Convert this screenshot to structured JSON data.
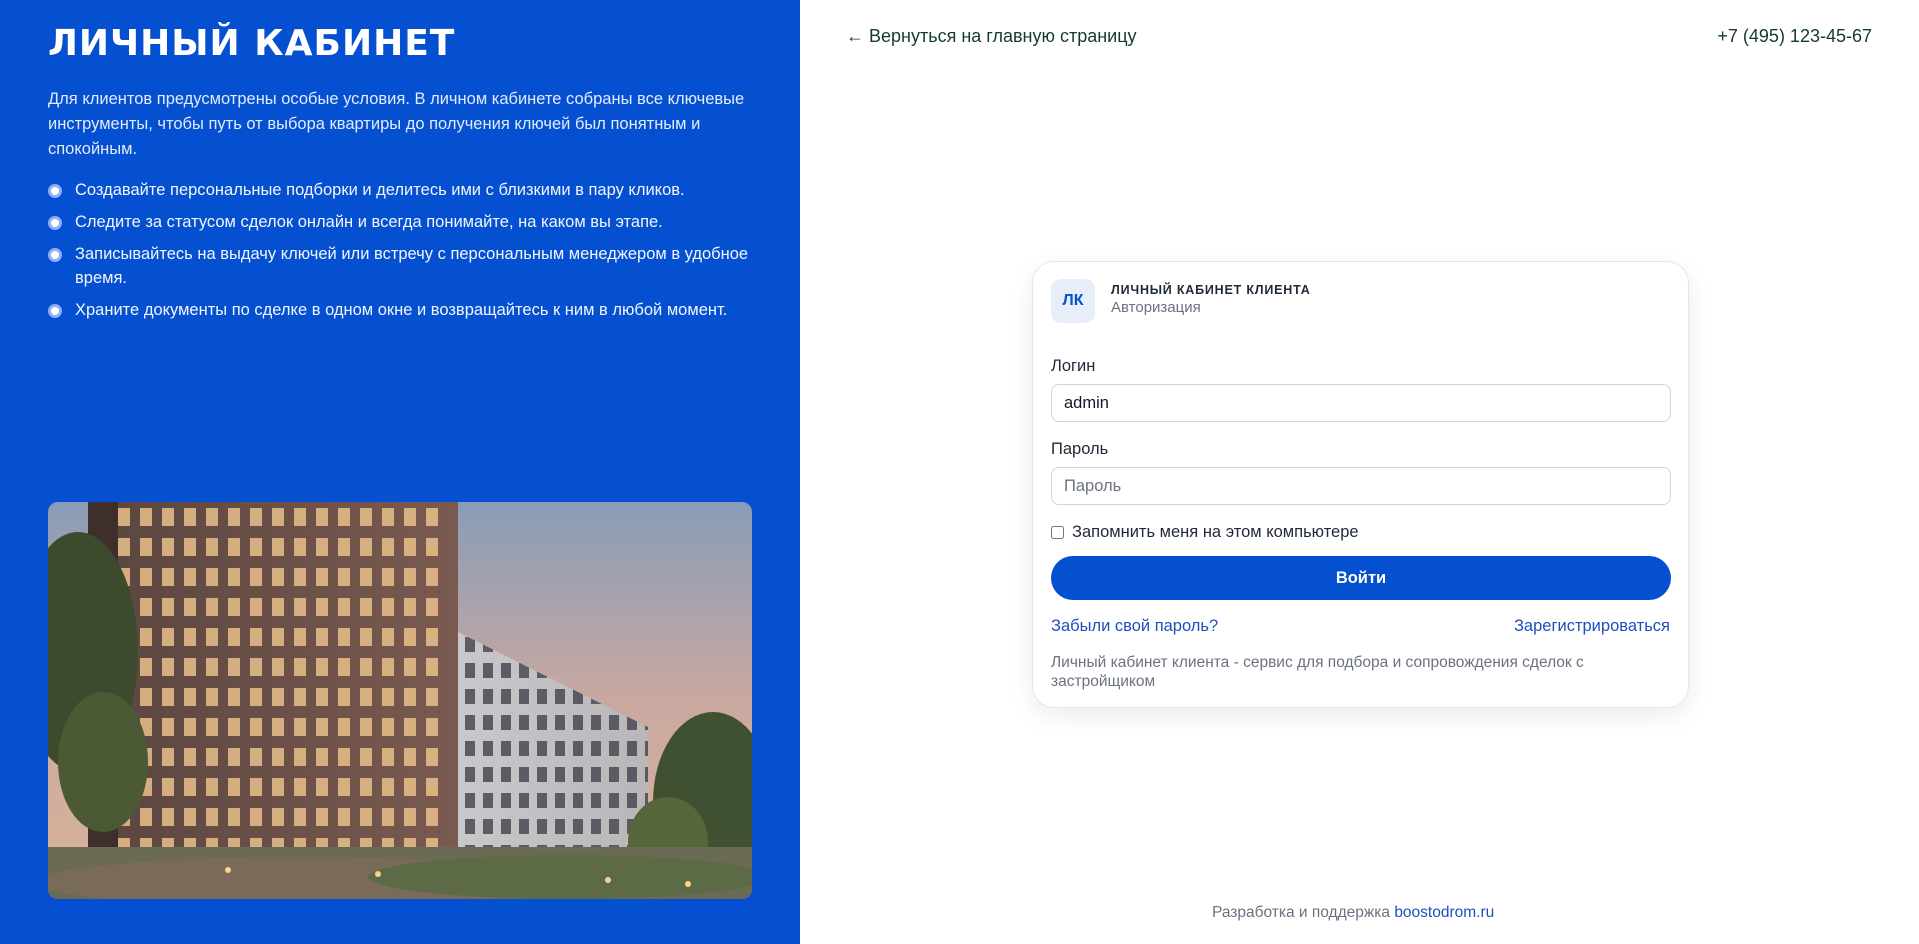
{
  "left": {
    "title": "ЛИЧНЫЙ КАБИНЕТ",
    "intro": "Для клиентов предусмотрены особые условия. В личном кабинете собраны все ключевые инструменты, чтобы путь от выбора квартиры до получения ключей был понятным и спокойным.",
    "features": [
      "Создавайте персональные подборки и делитесь ими с близкими в пару кликов.",
      "Следите за статусом сделок онлайн и всегда понимайте, на каком вы этапе.",
      "Записывайтесь на выдачу ключей или встречу с персональным менеджером в удобное время.",
      "Храните документы по сделке в одном окне и возвращайтесь к ним в любой момент."
    ]
  },
  "header": {
    "back_link": "← Вернуться на главную страницу",
    "phone": "+7 (495) 123-45-67"
  },
  "login_card": {
    "logo_text": "ЛК",
    "title": "ЛИЧНЫЙ КАБИНЕТ КЛИЕНТА",
    "subtitle": "Авторизация",
    "login_label": "Логин",
    "login_value": "admin",
    "password_label": "Пароль",
    "password_placeholder": "Пароль",
    "remember_label": "Запомнить меня на этом компьютере",
    "remember_checked": false,
    "submit_label": "Войти",
    "forgot_link": "Забыли свой пароль?",
    "register_link": "Зарегистрироваться",
    "note": "Личный кабинет клиента - сервис для подбора и сопровождения сделок с застройщиком"
  },
  "footer": {
    "text": "Разработка и поддержка",
    "link": "boostodrom.ru"
  },
  "colors": {
    "brand_blue": "#0550d0",
    "link_blue": "#1d4fbe",
    "dark_green_text": "#153b2c"
  }
}
